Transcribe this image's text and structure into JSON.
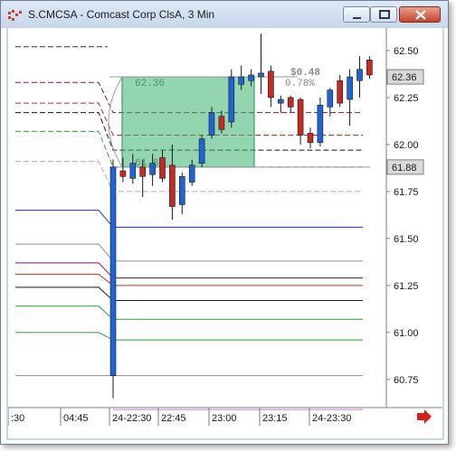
{
  "window": {
    "title": "S.CMCSA - Comcast Corp ClsA, 3 Min",
    "minimize_icon": "minimize-icon",
    "maximize_icon": "maximize-icon",
    "close_icon": "close-icon"
  },
  "chart_data": {
    "type": "candlestick",
    "symbol": "S.CMCSA",
    "ylim": [
      60.6,
      62.62
    ],
    "y_ticks": [
      "62.50",
      "62.25",
      "62.00",
      "61.75",
      "61.50",
      "61.25",
      "61.00",
      "60.75"
    ],
    "x_ticks": [
      ":30",
      "04:45",
      "24-22:30",
      "22:45",
      "23:00",
      "23:15",
      "24-23:30"
    ],
    "last_price_label": "62.36",
    "crosshair_price_label": "61.88",
    "measure_box": {
      "start_price": "62.36",
      "end_price": "61.88",
      "change": "$0.48",
      "change_pct": "0.78%"
    },
    "candles": [
      {
        "o": 60.77,
        "h": 61.92,
        "l": 60.65,
        "c": 61.88,
        "dir": "up"
      },
      {
        "o": 61.86,
        "h": 61.93,
        "l": 61.8,
        "c": 61.83,
        "dir": "down"
      },
      {
        "o": 61.82,
        "h": 61.95,
        "l": 61.79,
        "c": 61.9,
        "dir": "up"
      },
      {
        "o": 61.88,
        "h": 61.92,
        "l": 61.72,
        "c": 61.83,
        "dir": "down"
      },
      {
        "o": 61.84,
        "h": 61.95,
        "l": 61.78,
        "c": 61.9,
        "dir": "up"
      },
      {
        "o": 61.93,
        "h": 61.97,
        "l": 61.8,
        "c": 61.82,
        "dir": "down"
      },
      {
        "o": 61.89,
        "h": 62.0,
        "l": 61.6,
        "c": 61.67,
        "dir": "down"
      },
      {
        "o": 61.68,
        "h": 61.85,
        "l": 61.63,
        "c": 61.83,
        "dir": "up"
      },
      {
        "o": 61.8,
        "h": 61.92,
        "l": 61.78,
        "c": 61.89,
        "dir": "up"
      },
      {
        "o": 61.9,
        "h": 62.05,
        "l": 61.88,
        "c": 62.03,
        "dir": "up"
      },
      {
        "o": 62.05,
        "h": 62.2,
        "l": 62.03,
        "c": 62.17,
        "dir": "up"
      },
      {
        "o": 62.15,
        "h": 62.18,
        "l": 62.06,
        "c": 62.08,
        "dir": "down"
      },
      {
        "o": 62.12,
        "h": 62.4,
        "l": 62.09,
        "c": 62.36,
        "dir": "up"
      },
      {
        "o": 62.32,
        "h": 62.42,
        "l": 62.29,
        "c": 62.36,
        "dir": "up"
      },
      {
        "o": 62.34,
        "h": 62.4,
        "l": 62.31,
        "c": 62.37,
        "dir": "up"
      },
      {
        "o": 62.38,
        "h": 62.59,
        "l": 62.27,
        "c": 62.36,
        "dir": "up"
      },
      {
        "o": 62.39,
        "h": 62.42,
        "l": 62.2,
        "c": 62.25,
        "dir": "down"
      },
      {
        "o": 62.24,
        "h": 62.26,
        "l": 62.17,
        "c": 62.22,
        "dir": "up"
      },
      {
        "o": 62.25,
        "h": 62.26,
        "l": 62.17,
        "c": 62.2,
        "dir": "down"
      },
      {
        "o": 62.24,
        "h": 62.25,
        "l": 62.0,
        "c": 62.05,
        "dir": "down"
      },
      {
        "o": 62.06,
        "h": 62.09,
        "l": 61.98,
        "c": 62.01,
        "dir": "down"
      },
      {
        "o": 62.01,
        "h": 62.25,
        "l": 61.99,
        "c": 62.21,
        "dir": "up"
      },
      {
        "o": 62.2,
        "h": 62.3,
        "l": 62.15,
        "c": 62.29,
        "dir": "up"
      },
      {
        "o": 62.34,
        "h": 62.37,
        "l": 62.2,
        "c": 62.22,
        "dir": "down"
      },
      {
        "o": 62.24,
        "h": 62.4,
        "l": 62.1,
        "c": 62.36,
        "dir": "up"
      },
      {
        "o": 62.34,
        "h": 62.47,
        "l": 62.25,
        "c": 62.4,
        "dir": "up"
      },
      {
        "o": 62.45,
        "h": 62.47,
        "l": 62.35,
        "c": 62.37,
        "dir": "down"
      }
    ],
    "levels": [
      {
        "name": "level-navy-dashed",
        "color": "#1f2a8c",
        "dashed": true,
        "pre": 62.52,
        "post": null
      },
      {
        "name": "level-purple",
        "color": "#7a1a6e",
        "dashed": true,
        "pre": 62.33,
        "post": 62.17
      },
      {
        "name": "level-red",
        "color": "#c0302a",
        "dashed": true,
        "pre": 62.22,
        "post": 62.05
      },
      {
        "name": "level-black",
        "color": "#1a1a1a",
        "dashed": true,
        "pre": 62.17,
        "post": 61.97
      },
      {
        "name": "level-green",
        "color": "#2ea52e",
        "dashed": true,
        "pre": 62.07,
        "post": 61.88
      },
      {
        "name": "level-pink",
        "color": "#d98ee0",
        "dashed": true,
        "pre": 61.91,
        "post": 61.75
      },
      {
        "name": "level-blue",
        "color": "#2233bb",
        "dashed": false,
        "pre": 61.65,
        "post": 61.56
      },
      {
        "name": "level-gray",
        "color": "#909090",
        "dashed": false,
        "pre": 61.47,
        "post": 61.38
      },
      {
        "name": "level-purple-2",
        "color": "#7a1a6e",
        "dashed": false,
        "pre": 61.37,
        "post": 61.29
      },
      {
        "name": "level-red-2",
        "color": "#c0302a",
        "dashed": false,
        "pre": 61.31,
        "post": 61.25
      },
      {
        "name": "level-black-2",
        "color": "#1a1a1a",
        "dashed": false,
        "pre": 61.24,
        "post": 61.17
      },
      {
        "name": "level-green-2",
        "color": "#2ea52e",
        "dashed": false,
        "pre": 61.14,
        "post": 61.07
      },
      {
        "name": "level-green-3",
        "color": "#2ea52e",
        "dashed": false,
        "pre": 61.0,
        "post": 60.96
      },
      {
        "name": "level-gray-2",
        "color": "#909090",
        "dashed": false,
        "pre": 60.77,
        "post": 60.77
      },
      {
        "name": "level-pink-2",
        "color": "#e070e0",
        "dashed": false,
        "pre": null,
        "post": 60.59
      }
    ],
    "colors": {
      "up": "#1e64d2",
      "down": "#c42a22",
      "measure_fill": "#3cb371"
    }
  }
}
